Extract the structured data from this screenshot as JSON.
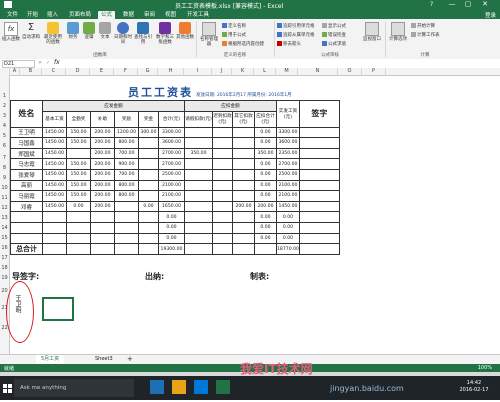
{
  "title_bar": {
    "title": "员工工资表模板.xlsx  [兼容模式] - Excel",
    "help": "?",
    "min": "—",
    "max": "▢",
    "close": "✕"
  },
  "tabs": [
    "文件",
    "开始",
    "插入",
    "页面布局",
    "公式",
    "数据",
    "审阅",
    "视图",
    "开发工具"
  ],
  "active_tab": "公式",
  "login": "登录",
  "ribbon": {
    "buttons": [
      {
        "label": "插入函数",
        "icon": "fx-icon"
      },
      {
        "label": "自动求和",
        "icon": "sum-icon"
      },
      {
        "label": "最近使用的函数",
        "icon": "recent-icon"
      },
      {
        "label": "财务",
        "icon": "finance-icon"
      },
      {
        "label": "逻辑",
        "icon": "logic-icon"
      },
      {
        "label": "文本",
        "icon": "text-icon"
      },
      {
        "label": "日期和时间",
        "icon": "clock-icon"
      },
      {
        "label": "查找与引用",
        "icon": "lookup-icon"
      },
      {
        "label": "数学和三角函数",
        "icon": "math-icon"
      },
      {
        "label": "其他函数",
        "icon": "more-icon"
      },
      {
        "label": "名称管理器",
        "icon": "name-icon"
      },
      {
        "label": "监视窗口",
        "icon": "watch-icon"
      },
      {
        "label": "计算选项",
        "icon": "calc-icon"
      }
    ],
    "small": [
      "定义名称",
      "用于公式",
      "根据所选内容创建",
      "追踪引用单元格",
      "追踪从属单元格",
      "移去箭头",
      "显示公式",
      "错误检查",
      "公式求值",
      "开始计算",
      "计算工作表"
    ],
    "groups": [
      "函数库",
      "定义的名称",
      "公式审核",
      "计算"
    ]
  },
  "formula_bar": {
    "namebox": "D21",
    "fx": "fx",
    "value": ""
  },
  "columns": [
    "A",
    "B",
    "C",
    "D",
    "E",
    "F",
    "G",
    "H",
    "I",
    "J",
    "K",
    "L",
    "M",
    "N",
    "O",
    "P"
  ],
  "rows": [
    "1",
    "2",
    "3",
    "4",
    "5",
    "6",
    "7",
    "8",
    "9",
    "10",
    "11",
    "12",
    "13",
    "14",
    "15",
    "16",
    "17",
    "18",
    "19",
    "20",
    "21",
    "22"
  ],
  "sheet": {
    "title": "员工工资表",
    "date_label": "发放日期: 2016年2月17 所属月份: 2016年1月",
    "header_name": "姓名",
    "header_sign": "签字",
    "group_due": "应发金额",
    "group_deduct": "应扣金额",
    "sub_headers": [
      "基本工资",
      "全勤奖",
      "补助",
      "奖励",
      "奖金",
      "合计(元)",
      "请假扣款(元)",
      "迟到扣款(元)",
      "其它扣款(元)",
      "应扣合计(元)",
      "实发工资(元)"
    ],
    "rows": [
      {
        "name": "王卫明",
        "vals": [
          "1450.00",
          "150.00",
          "200.00",
          "1200.00",
          "300.00",
          "3300.00",
          "",
          "",
          "",
          "0.00",
          "3300.00"
        ]
      },
      {
        "name": "马国鑫",
        "vals": [
          "1450.00",
          "150.00",
          "200.00",
          "800.00",
          "",
          "3600.00",
          "",
          "",
          "",
          "0.00",
          "3600.00"
        ]
      },
      {
        "name": "郑国斌",
        "vals": [
          "1450.00",
          "",
          "200.00",
          "700.00",
          "",
          "2700.00",
          "350.00",
          "",
          "",
          "350.00",
          "2350.00"
        ]
      },
      {
        "name": "马志霞",
        "vals": [
          "1450.00",
          "150.00",
          "200.00",
          "900.00",
          "",
          "2700.00",
          "",
          "",
          "",
          "0.00",
          "2700.00"
        ]
      },
      {
        "name": "张爱琴",
        "vals": [
          "1450.00",
          "150.00",
          "200.00",
          "700.00",
          "",
          "2500.00",
          "",
          "",
          "",
          "0.00",
          "2500.00"
        ]
      },
      {
        "name": "高丽",
        "vals": [
          "1450.00",
          "150.00",
          "200.00",
          "800.00",
          "",
          "2100.00",
          "",
          "",
          "",
          "0.00",
          "2100.00"
        ]
      },
      {
        "name": "马丽霞",
        "vals": [
          "1450.00",
          "150.00",
          "200.00",
          "800.00",
          "",
          "2100.00",
          "",
          "",
          "",
          "0.00",
          "2100.00"
        ]
      },
      {
        "name": "邓睿",
        "vals": [
          "1450.00",
          "0.00",
          "200.00",
          "",
          "0.00",
          "1650.00",
          "",
          "",
          "200.00",
          "200.00",
          "1450.00"
        ]
      },
      {
        "name": "",
        "vals": [
          "",
          "",
          "",
          "",
          "",
          "0.00",
          "",
          "",
          "",
          "0.00",
          "0.00"
        ]
      },
      {
        "name": "",
        "vals": [
          "",
          "",
          "",
          "",
          "",
          "0.00",
          "",
          "",
          "",
          "0.00",
          "0.00"
        ]
      },
      {
        "name": "",
        "vals": [
          "",
          "",
          "",
          "",
          "",
          "0.00",
          "",
          "",
          "",
          "0.00",
          "0.00"
        ]
      }
    ],
    "total_label": "总合计",
    "total_h": "19300.00",
    "total_m": "18770.00",
    "footer_sign": "导签字:",
    "footer_cashier": "出纳:",
    "footer_maker": "制表:",
    "signature": "王卫明"
  },
  "sheet_tabs": [
    "5月工资",
    "Sheet3"
  ],
  "add_sheet": "+",
  "status": {
    "ready": "就绪",
    "zoom": "100%"
  },
  "taskbar": {
    "search": "Ask me anything",
    "time": "14:42",
    "date": "2016-02-17",
    "watermark": "jingyan.baidu.com",
    "watermark2": "我爱IT技术网"
  },
  "colors": {
    "excel_green": "#217346",
    "taskbar": "#1f2428",
    "signature_circle": "#d81e1e"
  }
}
